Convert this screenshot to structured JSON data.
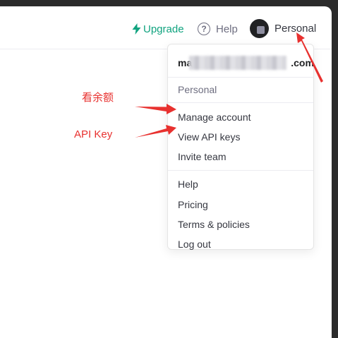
{
  "topbar": {
    "upgrade_label": "Upgrade",
    "help_label": "Help",
    "help_icon_glyph": "?",
    "account_label": "Personal"
  },
  "menu": {
    "email_prefix": "ma",
    "email_suffix": ".com",
    "org_label": "Personal",
    "group1": [
      "Manage account",
      "View API keys",
      "Invite team"
    ],
    "group2": [
      "Help",
      "Pricing",
      "Terms & policies",
      "Log out"
    ]
  },
  "annotations": {
    "balance_note": "看余额",
    "api_key_note": "API Key"
  },
  "colors": {
    "accent_green": "#10a37f",
    "annotation_red": "#e8312f",
    "text_primary": "#353740",
    "text_muted": "#6e6e80"
  }
}
